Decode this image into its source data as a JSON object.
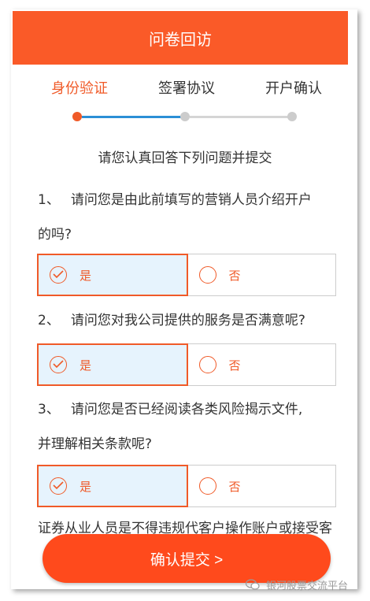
{
  "header": {
    "title": "问卷回访"
  },
  "steps": [
    {
      "label": "身份验证",
      "active": true
    },
    {
      "label": "签署协议",
      "active": false
    },
    {
      "label": "开户确认",
      "active": false
    }
  ],
  "colors": {
    "brand": "#fa5a28",
    "active_step": "#f05a28",
    "progress_done": "#2b8fd6",
    "progress_todo": "#cccccc",
    "selected_bg": "#e6f3fd"
  },
  "instruction": "请您认真回答下列问题并提交",
  "questions": [
    {
      "number": "1、",
      "line1": "请问您是由此前填写的营销人员介绍开户",
      "line2": "的吗?",
      "options": [
        {
          "label": "是",
          "selected": true
        },
        {
          "label": "否",
          "selected": false
        }
      ]
    },
    {
      "number": "2、",
      "line1": "请问您对我公司提供的服务是否满意呢?",
      "line2": "",
      "options": [
        {
          "label": "是",
          "selected": true
        },
        {
          "label": "否",
          "selected": false
        }
      ]
    },
    {
      "number": "3、",
      "line1": "请问您是否已经阅读各类风险揭示文件,",
      "line2": "并理解相关条款呢?",
      "options": [
        {
          "label": "是",
          "selected": true
        },
        {
          "label": "否",
          "selected": false
        }
      ]
    }
  ],
  "disclaimer": "证券从业人员是不得违规代客户操作账户或接受客",
  "confirm_button": "确认提交 >",
  "watermark": {
    "text": "银河股票交流平台",
    "icon": "wechat-icon"
  }
}
